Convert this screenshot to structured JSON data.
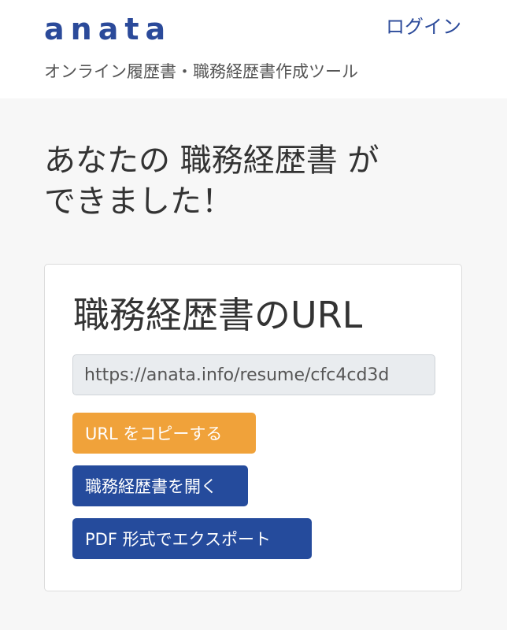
{
  "header": {
    "logo": "anata",
    "login_label": "ログイン",
    "tagline": "オンライン履歴書・職務経歴書作成ツール"
  },
  "main": {
    "headline_line1": "あなたの 職務経歴書 が",
    "headline_line2": "できました！",
    "card": {
      "title": "職務経歴書のURL",
      "url_value": "https://anata.info/resume/cfc4cd3d",
      "copy_button": "URL をコピーする",
      "open_button": "職務経歴書を開く",
      "pdf_button": "PDF 形式でエクスポート"
    }
  },
  "colors": {
    "brand": "#2b4a9a",
    "copy_button": "#f0a23a",
    "primary_button": "#254b9c",
    "page_background": "#f7f7f7"
  }
}
